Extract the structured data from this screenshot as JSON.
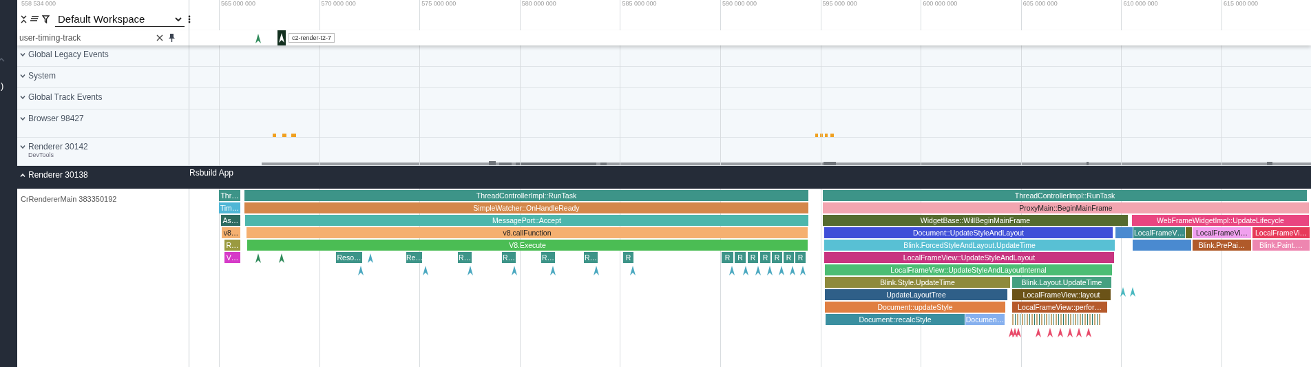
{
  "sidebar": {
    "text": ")"
  },
  "ruler": {
    "start": "558 534 000",
    "ticks": [
      "565 000 000",
      "570 000 000",
      "575 000 000",
      "580 000 000",
      "585 000 000",
      "590 000 000",
      "595 000 000",
      "600 000 000",
      "605 000 000",
      "610 000 000",
      "615 000 000"
    ]
  },
  "toolbar": {
    "workspace": "Default Workspace"
  },
  "pinned_track": {
    "name": "user-timing-track",
    "tooltip": "c2-render-t2-7"
  },
  "tracks": [
    {
      "name": "Global Legacy Events",
      "expanded": false
    },
    {
      "name": "System",
      "expanded": false
    },
    {
      "name": "Global Track Events",
      "expanded": false
    },
    {
      "name": "Browser 98427",
      "expanded": false
    },
    {
      "name": "Renderer 30142",
      "subtitle": "DevTools",
      "expanded": false
    },
    {
      "name": "Renderer 30138",
      "expanded": true,
      "title": "Rsbuild App"
    }
  ],
  "thread": {
    "name": "CrRendererMain 383350192",
    "slices": [
      {
        "label": "Thr…",
        "color": "#3d9488"
      },
      {
        "label": "ThreadControllerImpl::RunTask",
        "color": "#3d9488"
      },
      {
        "label": "Tim…",
        "color": "#4fb6d6"
      },
      {
        "label": "SimpleWatcher::OnHandleReady",
        "color": "#d4874a"
      },
      {
        "label": "As…",
        "color": "#2e6b60"
      },
      {
        "label": "MessagePort::Accept",
        "color": "#4db6ac"
      },
      {
        "label": "v8…",
        "color": "#f5b070"
      },
      {
        "label": "v8.callFunction",
        "color": "#f5b070"
      },
      {
        "label": "R…",
        "color": "#9a9a40"
      },
      {
        "label": "V8.Execute",
        "color": "#4bbd54"
      },
      {
        "label": "V…",
        "color": "#d63bc8"
      },
      {
        "label": "Reso…",
        "color": "#3d9488"
      },
      {
        "label": "Re…",
        "color": "#3d9488"
      },
      {
        "label": "R…",
        "color": "#3d9488"
      },
      {
        "label": "R…",
        "color": "#3d9488"
      },
      {
        "label": "R…",
        "color": "#3d9488"
      },
      {
        "label": "R…",
        "color": "#3d9488"
      },
      {
        "label": "R",
        "color": "#3d9488"
      },
      {
        "label": "R",
        "color": "#3d9488"
      },
      {
        "label": "R",
        "color": "#3d9488"
      },
      {
        "label": "R",
        "color": "#3d9488"
      },
      {
        "label": "R",
        "color": "#3d9488"
      },
      {
        "label": "R",
        "color": "#3d9488"
      },
      {
        "label": "R",
        "color": "#3d9488"
      },
      {
        "label": "R",
        "color": "#3d9488"
      },
      {
        "label": "ThreadControllerImpl::RunTask",
        "color": "#3d9488"
      },
      {
        "label": "ProxyMain::BeginMainFrame",
        "color": "#f2a5b0"
      },
      {
        "label": "WidgetBase::WillBeginMainFrame",
        "color": "#556b2f"
      },
      {
        "label": "WebFrameWidgetImpl::UpdateLifecycle",
        "color": "#e94580"
      },
      {
        "label": "Document::UpdateStyleAndLayout",
        "color": "#3f4fd8"
      },
      {
        "label": "LocalFrameV…",
        "color": "#3a8f8a"
      },
      {
        "label": "LocalFrameVi…",
        "color": "#f0a0ee"
      },
      {
        "label": "LocalFrameVi…",
        "color": "#e73a5a"
      },
      {
        "label": "Blink.ForcedStyleAndLayout.UpdateTime",
        "color": "#58c0d4"
      },
      {
        "label": "Blink.PrePai…",
        "color": "#b05a2a"
      },
      {
        "label": "Blink.Paint.…",
        "color": "#ee86b0"
      },
      {
        "label": "LocalFrameView::UpdateStyleAndLayout",
        "color": "#c83480"
      },
      {
        "label": "LocalFrameView::UpdateStyleAndLayoutInternal",
        "color": "#4cbd74"
      },
      {
        "label": "Blink.Style.UpdateTime",
        "color": "#8e8a3c"
      },
      {
        "label": "Blink.Layout.UpdateTime",
        "color": "#45a080"
      },
      {
        "label": "UpdateLayoutTree",
        "color": "#2f5f88"
      },
      {
        "label": "LocalFrameView::layout",
        "color": "#6b5318"
      },
      {
        "label": "Document::updateStyle",
        "color": "#e07f42"
      },
      {
        "label": "LocalFrameView::perfor…",
        "color": "#b65a2c"
      },
      {
        "label": "Document::recalcStyle",
        "color": "#3a8fa0"
      },
      {
        "label": "Documen…",
        "color": "#86b0ee"
      }
    ]
  }
}
